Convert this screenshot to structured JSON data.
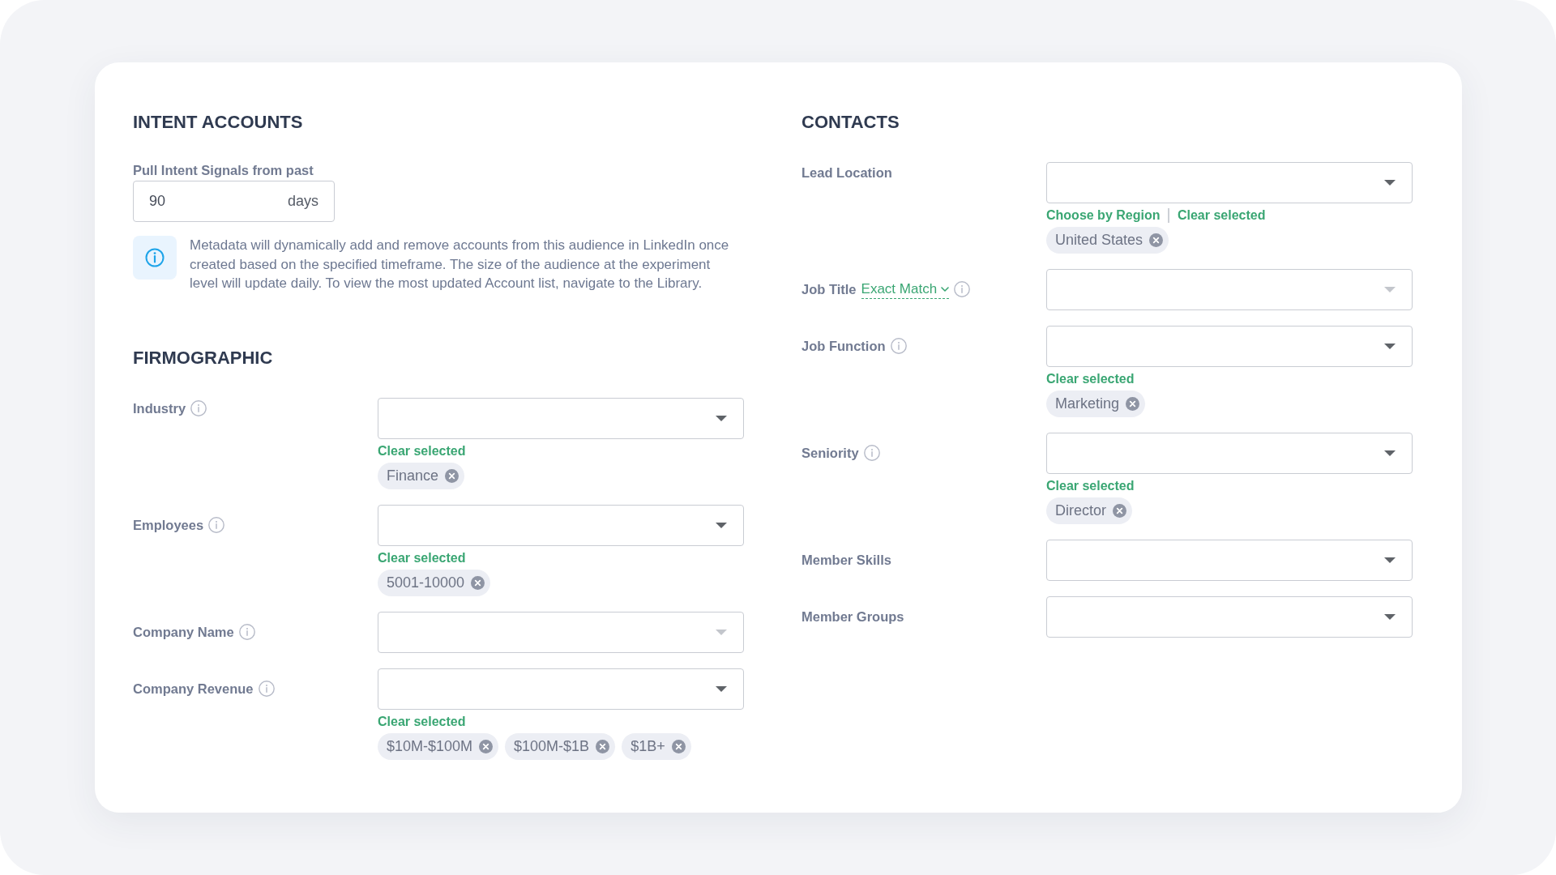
{
  "intent_accounts": {
    "title": "INTENT ACCOUNTS",
    "lookback": {
      "label": "Pull Intent Signals from past",
      "value": "90",
      "unit": "days"
    },
    "notice": "Metadata will dynamically add and remove accounts from this audience in LinkedIn once created based on the specified timeframe. The size of the audience at the experiment level will update daily. To view the most updated Account list, navigate to the Library."
  },
  "firmographic": {
    "title": "FIRMOGRAPHIC",
    "fields": [
      {
        "label": "Industry",
        "info": true,
        "kind": "select",
        "links": [
          "Clear selected"
        ],
        "chips": [
          "Finance"
        ]
      },
      {
        "label": "Employees",
        "info": true,
        "kind": "select",
        "links": [
          "Clear selected"
        ],
        "chips": [
          "5001-10000"
        ]
      },
      {
        "label": "Company Name",
        "info": true,
        "kind": "typeahead"
      },
      {
        "label": "Company Revenue",
        "info": true,
        "kind": "select",
        "links": [
          "Clear selected"
        ],
        "chips": [
          "$10M-$100M",
          "$100M-$1B",
          "$1B+"
        ]
      }
    ]
  },
  "contacts": {
    "title": "CONTACTS",
    "fields": [
      {
        "label": "Lead Location",
        "info": false,
        "kind": "select",
        "links": [
          "Choose by Region",
          "Clear selected"
        ],
        "chips": [
          "United States"
        ]
      },
      {
        "label": "Job Title",
        "match": "Exact Match",
        "info": true,
        "kind": "typeahead"
      },
      {
        "label": "Job Function",
        "info": true,
        "kind": "select",
        "links": [
          "Clear selected"
        ],
        "chips": [
          "Marketing"
        ]
      },
      {
        "label": "Seniority",
        "info": true,
        "kind": "select",
        "links": [
          "Clear selected"
        ],
        "chips": [
          "Director"
        ]
      },
      {
        "label": "Member Skills",
        "info": false,
        "kind": "select"
      },
      {
        "label": "Member Groups",
        "info": false,
        "kind": "select"
      }
    ]
  }
}
